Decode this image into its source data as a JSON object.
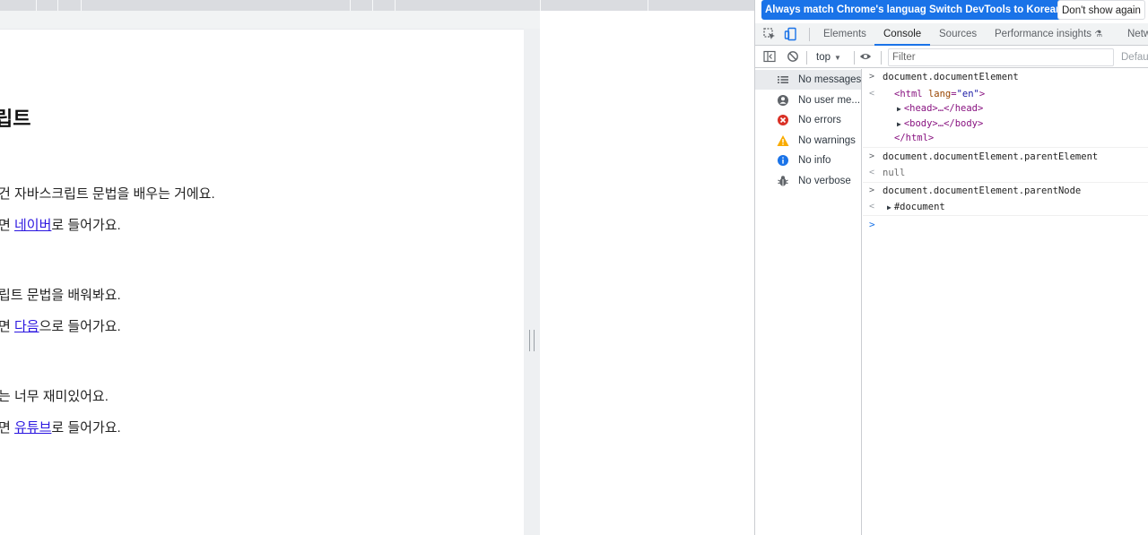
{
  "page": {
    "title": "립트",
    "lines": [
      {
        "before": "건 자바스크립트 문법을 배우는 거에요.",
        "link": "",
        "after": ""
      },
      {
        "before": "면 ",
        "link": "네이버",
        "after": "로 들어가요."
      },
      {
        "before": "립트 문법을 배워봐요.",
        "link": "",
        "after": ""
      },
      {
        "before": "면 ",
        "link": "다음",
        "after": "으로 들어가요."
      },
      {
        "before": "는 너무 재미있어요.",
        "link": "",
        "after": ""
      },
      {
        "before": "면 ",
        "link": "유튜브",
        "after": "로 들어가요."
      }
    ]
  },
  "devtools": {
    "language_bar": {
      "always_match": "Always match Chrome's language",
      "switch_korean": "Switch DevTools to Korean",
      "dont_show": "Don't show again"
    },
    "tabs": [
      "Elements",
      "Console",
      "Sources",
      "Performance insights",
      "Netw"
    ],
    "active_tab": "Console",
    "console_toolbar": {
      "context": "top",
      "filter_placeholder": "Filter",
      "levels": "Defau"
    },
    "sidebar": [
      {
        "label": "No messages",
        "icon": "list-icon"
      },
      {
        "label": "No user me...",
        "icon": "user-icon"
      },
      {
        "label": "No errors",
        "icon": "error-icon"
      },
      {
        "label": "No warnings",
        "icon": "warning-icon"
      },
      {
        "label": "No info",
        "icon": "info-icon"
      },
      {
        "label": "No verbose",
        "icon": "bug-icon"
      }
    ],
    "console": {
      "cmd1": "document.documentElement",
      "html_open_tag": "<html",
      "html_attr": "lang",
      "html_attr_value": "\"en\"",
      "html_open_close": ">",
      "head": "<head>…</head>",
      "body": "<body>…</body>",
      "html_close": "</html>",
      "cmd2": "document.documentElement.parentElement",
      "res2": "null",
      "cmd3": "document.documentElement.parentNode",
      "res3": "#document"
    },
    "colors": {
      "accent": "#1a73e8",
      "error": "#d93025",
      "warning": "#f9ab00",
      "info": "#1a73e8"
    }
  }
}
